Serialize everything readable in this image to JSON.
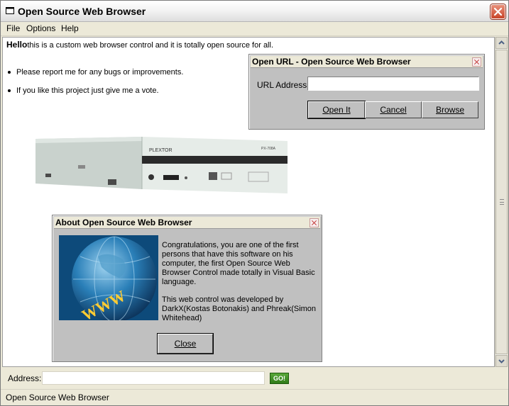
{
  "window": {
    "title": "Open Source Web Browser"
  },
  "menu": {
    "items": [
      "File",
      "Options",
      "Help"
    ]
  },
  "content": {
    "hello_bold": "Hello",
    "hello_rest": "this is a custom web browser control and it is totally open source for all.",
    "bullets": [
      "Please report me for any bugs or improvements.",
      "If you like this project just give me a vote."
    ],
    "drive_brand": "PLEXTOR",
    "drive_model": "PX-708A"
  },
  "open_url_dialog": {
    "title": "Open URL - Open Source Web Browser",
    "url_label": "URL Address:",
    "url_value": "",
    "open_label": "Open It",
    "cancel_label": "Cancel",
    "browse_label": "Browse"
  },
  "about_dialog": {
    "title": "About Open Source Web Browser",
    "image_text": "WWW",
    "para1": "Congratulations, you are one of the first persons that have this software on his computer, the first Open Source Web Browser Control made totally in Visual Basic language.",
    "para2": "This web control was developed by DarkX(Kostas Botonakis) and Phreak(Simon Whitehead)",
    "close_label": "Close"
  },
  "address_bar": {
    "label": "Address:",
    "value": "",
    "go_label": "GO!"
  },
  "status_bar": {
    "text": "Open Source Web Browser"
  },
  "colors": {
    "dialog_bg": "#c0c0c0",
    "go_green": "#2f7b18",
    "close_red": "#c8452a"
  }
}
